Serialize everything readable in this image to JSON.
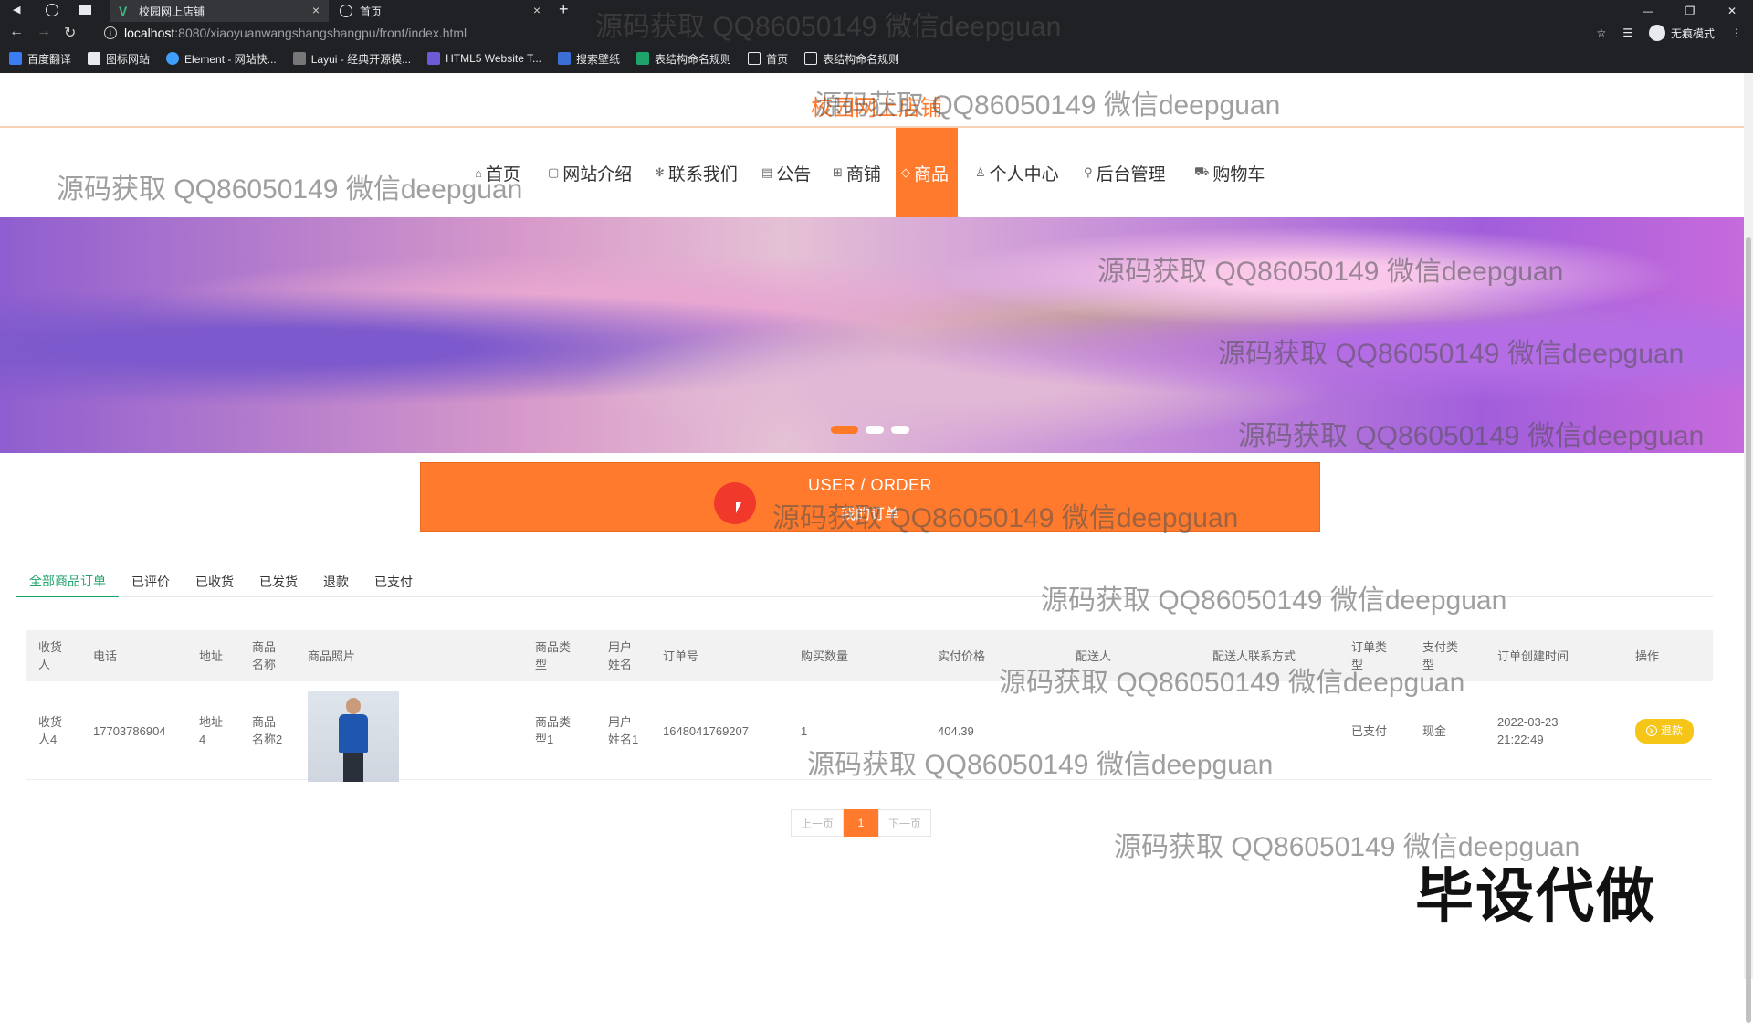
{
  "browser": {
    "tabs": [
      {
        "title": "校园网上店铺",
        "active": true
      },
      {
        "title": "首页",
        "active": false
      }
    ],
    "url_host": "localhost",
    "url_path": ":8080/xiaoyuanwangshangshangpu/front/index.html",
    "incognito_label": "无痕模式",
    "bookmarks": [
      "百度翻译",
      "图标网站",
      "Element - 网站快...",
      "Layui - 经典开源模...",
      "HTML5 Website T...",
      "搜索壁纸",
      "表结构命名规则",
      "首页",
      "表结构命名规则"
    ]
  },
  "site": {
    "title": "校园网上店铺",
    "accent": "#ff7a2c",
    "nav": [
      {
        "label": "首页",
        "icon": "home-icon"
      },
      {
        "label": "网站介绍",
        "icon": "doc-icon"
      },
      {
        "label": "联系我们",
        "icon": "asterisk-icon"
      },
      {
        "label": "公告",
        "icon": "notice-icon"
      },
      {
        "label": "商铺",
        "icon": "grid-icon"
      },
      {
        "label": "商品",
        "icon": "tag-icon",
        "active": true
      },
      {
        "label": "个人中心",
        "icon": "user-icon"
      },
      {
        "label": "后台管理",
        "icon": "link-icon"
      },
      {
        "label": "购物车",
        "icon": "cart-icon"
      }
    ]
  },
  "banner": {
    "slide_count": 3,
    "active_slide": 1
  },
  "order_header": {
    "en": "USER / ORDER",
    "cn": "我的订单"
  },
  "order_tabs": [
    "全部商品订单",
    "已评价",
    "已收货",
    "已发货",
    "退款",
    "已支付"
  ],
  "table": {
    "headers": [
      "收货人",
      "电话",
      "地址",
      "商品名称",
      "商品照片",
      "商品类型",
      "用户姓名",
      "订单号",
      "购买数量",
      "实付价格",
      "配送人",
      "配送人联系方式",
      "订单类型",
      "支付类型",
      "订单创建时间",
      "操作"
    ],
    "rows": [
      {
        "receiver": "收货人4",
        "phone": "17703786904",
        "address": "地址4",
        "product_name": "商品名称2",
        "product_type": "商品类型1",
        "user_name": "用户姓名1",
        "order_no": "1648041769207",
        "quantity": "1",
        "price": "404.39",
        "courier": "",
        "courier_contact": "",
        "order_type": "已支付",
        "pay_type": "现金",
        "created": "2022-03-23 21:22:49",
        "action": "退款"
      }
    ]
  },
  "pager": {
    "prev": "上一页",
    "current": "1",
    "next": "下一页"
  },
  "watermark": "源码获取 QQ86050149 微信deepguan",
  "stamp": "毕设代做"
}
